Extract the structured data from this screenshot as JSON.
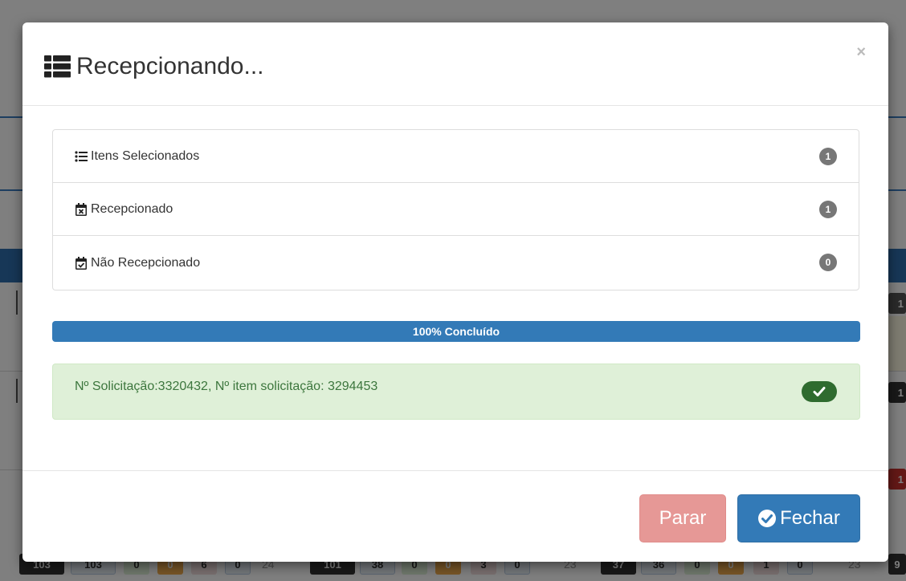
{
  "modal": {
    "title": "Recepcionando...",
    "close_glyph": "×",
    "title_icon": "list-icon"
  },
  "summary": {
    "items": [
      {
        "label": "Itens Selecionados",
        "count": "1",
        "icon": "list-ul-icon"
      },
      {
        "label": "Recepcionado",
        "count": "1",
        "icon": "calendar-times-icon"
      },
      {
        "label": "Não Recepcionado",
        "count": "0",
        "icon": "calendar-check-icon"
      }
    ]
  },
  "progress": {
    "percent": 100,
    "label": "100% Concluído",
    "color": "#337ab7"
  },
  "result": {
    "message": "Nº Solicitação:3320432, Nº item solicitação: 3294453",
    "status_icon": "check-icon",
    "color": "#dff0d8"
  },
  "footer": {
    "stop_label": "Parar",
    "close_label": "Fechar"
  },
  "background": {
    "bottom_cells": [
      "103",
      "103",
      "0",
      "0",
      "6",
      "0",
      "24",
      "101",
      "38",
      "0",
      "0",
      "3",
      "0",
      "23",
      "37",
      "36",
      "0",
      "0",
      "1",
      "0",
      "23",
      "9"
    ],
    "side_badges": [
      "1",
      "1",
      "1"
    ]
  }
}
